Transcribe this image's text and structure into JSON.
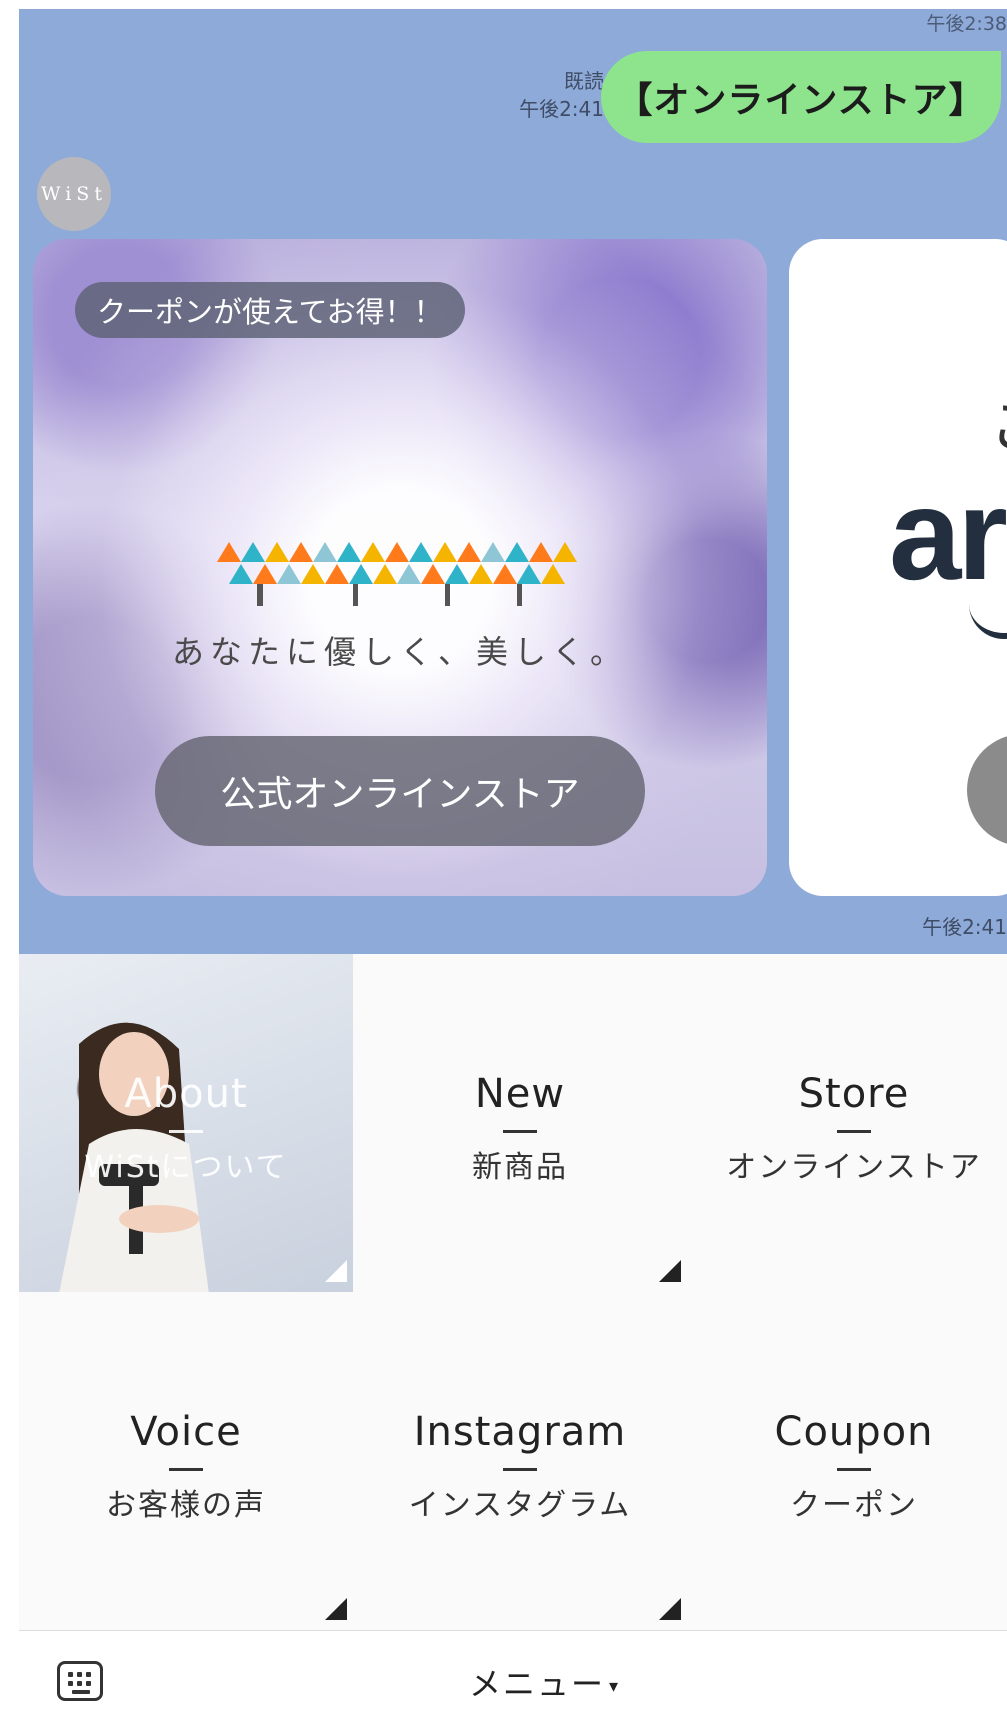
{
  "chat": {
    "top_timestamp": "午後2:38",
    "read_label": "既読",
    "sent_time": "午後2:41",
    "sent_message": "【オンラインストア】",
    "avatar_text": "WiSt",
    "bottom_timestamp": "午後2:41",
    "background_color": "#8eaad8",
    "bubble_color": "#8de48c"
  },
  "card_online_store": {
    "badge": "クーポンが使えてお得！！",
    "tagline": "あなたに優しく、美しく。",
    "button_label": "公式オンラインストア"
  },
  "card_amazon": {
    "top_glyph": "こ",
    "logo_text": "ar"
  },
  "rich_menu": {
    "cells": [
      {
        "en": "About",
        "jp": "WiStについて"
      },
      {
        "en": "New",
        "jp": "新商品"
      },
      {
        "en": "Store",
        "jp": "オンラインストア"
      },
      {
        "en": "Voice",
        "jp": "お客様の声"
      },
      {
        "en": "Instagram",
        "jp": "インスタグラム"
      },
      {
        "en": "Coupon",
        "jp": "クーポン"
      }
    ]
  },
  "bottom_bar": {
    "menu_label": "メニュー",
    "menu_caret": "▾",
    "keyboard_icon": "keyboard-icon"
  }
}
